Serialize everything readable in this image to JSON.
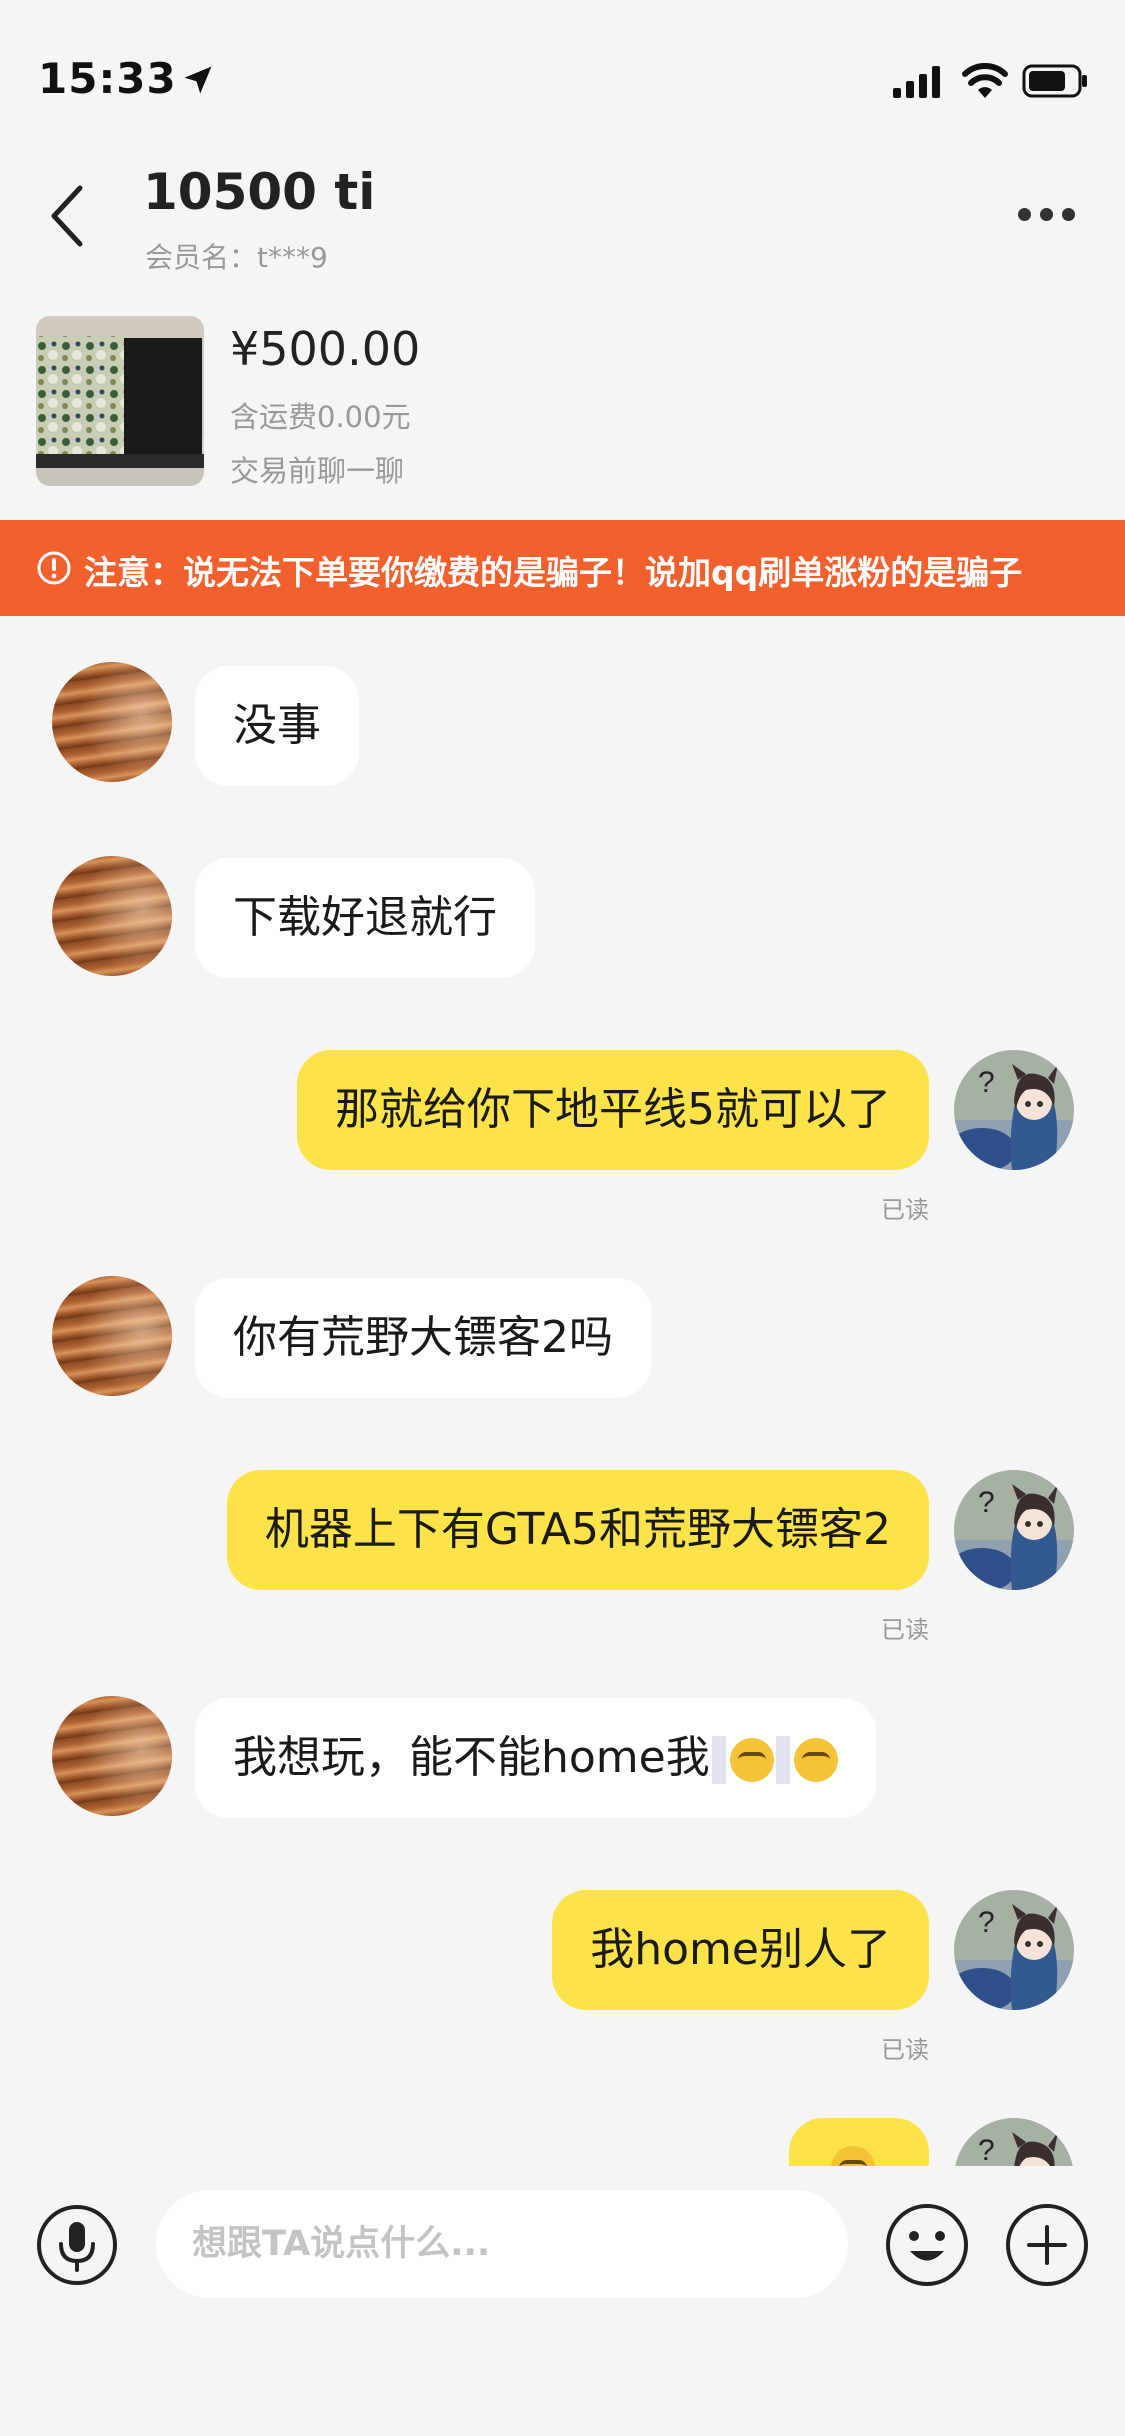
{
  "status_bar": {
    "time": "15:33"
  },
  "header": {
    "title": "10500 ti",
    "subtitle": "会员名：t***9"
  },
  "product": {
    "price": "¥500.00",
    "shipping": "含运费0.00元",
    "hint": "交易前聊一聊"
  },
  "warning": {
    "text": "注意：说无法下单要你缴费的是骗子！说加qq刷单涨粉的是骗子"
  },
  "messages": [
    {
      "from": "other",
      "text": "没事"
    },
    {
      "from": "other",
      "text": "下载好退就行"
    },
    {
      "from": "me",
      "text": "那就给你下地平线5就可以了",
      "status": "已读"
    },
    {
      "from": "other",
      "text": "你有荒野大镖客2吗"
    },
    {
      "from": "me",
      "text": "机器上下有GTA5和荒野大镖客2",
      "status": "已读"
    },
    {
      "from": "other",
      "text": "我想玩，能不能home我",
      "emojis": [
        "smirk-emoji",
        "smirk-emoji"
      ]
    },
    {
      "from": "me",
      "text": "我home别人了",
      "status": "已读"
    },
    {
      "from": "me",
      "text": "",
      "emojis": [
        "emoji"
      ]
    }
  ],
  "input": {
    "placeholder": "想跟TA说点什么..."
  },
  "icons": {
    "back": "chevron-left-icon",
    "more": "more-dots-icon",
    "warning": "exclamation-circle-icon",
    "mic": "microphone-icon",
    "emoji": "smiley-icon",
    "plus": "plus-icon"
  },
  "colors": {
    "warning_bg": "#f2602d",
    "my_bubble": "#fbe349",
    "other_bubble": "#ffffff",
    "background": "#f5f5f5"
  }
}
